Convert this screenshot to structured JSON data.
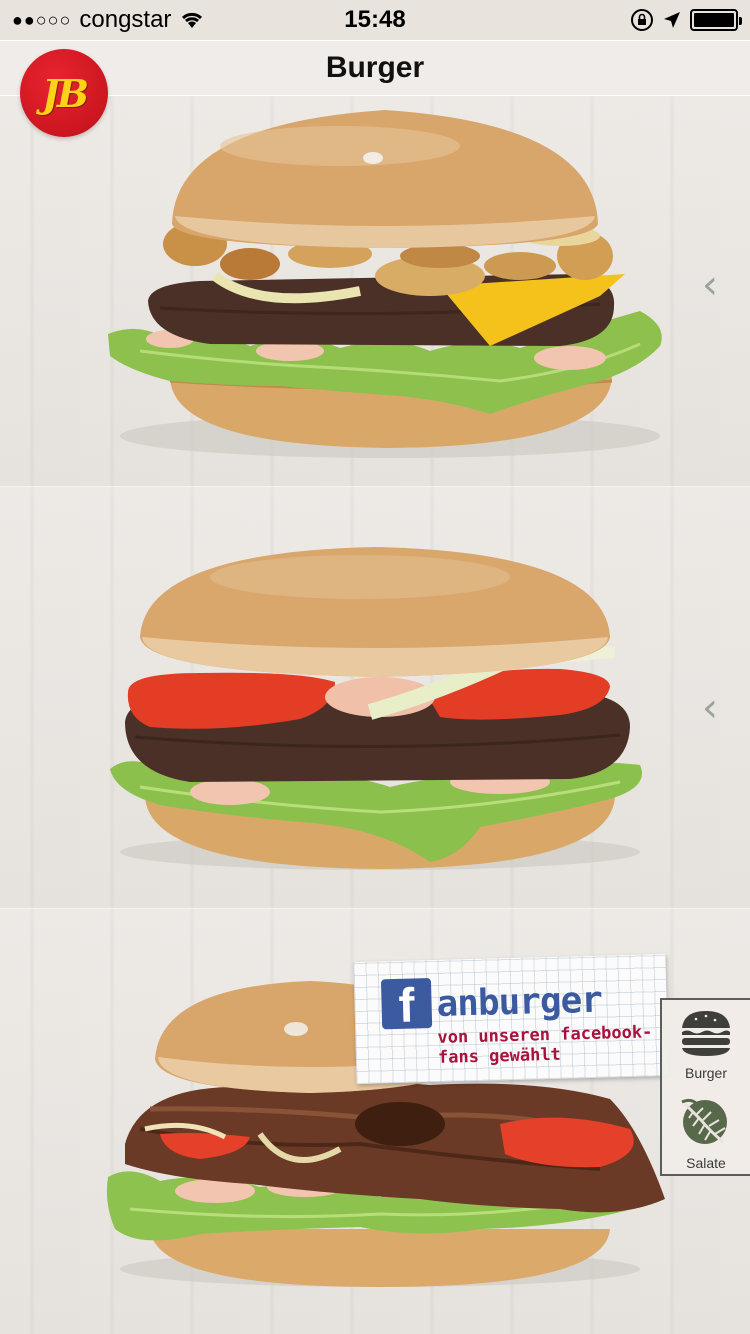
{
  "status_bar": {
    "signal_dots": "●●○○○",
    "carrier": "congstar",
    "time": "15:48"
  },
  "nav": {
    "title": "Burger",
    "logo_text": "JB"
  },
  "panels": [
    {
      "name": "mushroom-cheese-burger",
      "chevron": "‹"
    },
    {
      "name": "tomato-burger",
      "chevron": "‹"
    },
    {
      "name": "pulled-beef-burger"
    }
  ],
  "fan_label": {
    "icon_letter": "f",
    "title": "anburger",
    "subtitle": "von unseren facebook-fans gewählt"
  },
  "side_menu": {
    "items": [
      {
        "label": "Burger",
        "icon": "burger-icon"
      },
      {
        "label": "Salate",
        "icon": "salad-leaf-icon"
      }
    ]
  },
  "colors": {
    "logo_red": "#d41820",
    "logo_yellow": "#ffd21a",
    "facebook_blue": "#3b5aa0",
    "fan_subtitle": "#a8123c",
    "chevron": "#9aa39a"
  }
}
